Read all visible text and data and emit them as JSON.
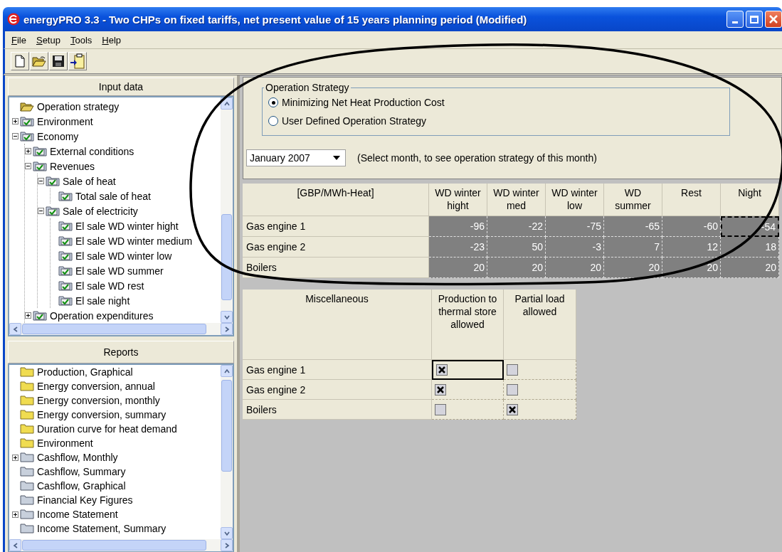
{
  "window": {
    "title": "energyPRO 3.3  -  Two CHPs on fixed tariffs, net present value of 15 years planning period (Modified)"
  },
  "menu": [
    {
      "label": "File"
    },
    {
      "label": "Setup"
    },
    {
      "label": "Tools"
    },
    {
      "label": "Help"
    }
  ],
  "toolbar": [
    {
      "kind": "new"
    },
    {
      "kind": "open"
    },
    {
      "kind": "save"
    },
    {
      "kind": "import"
    }
  ],
  "input_panel": {
    "title": "Input data",
    "tree": [
      {
        "label": "Operation strategy",
        "kind": "open-folder"
      },
      {
        "label": "Environment",
        "kind": "checked-folder",
        "expanded": false
      },
      {
        "label": "Economy",
        "kind": "checked-folder",
        "expanded": true,
        "children": [
          {
            "label": "External conditions",
            "kind": "checked-folder",
            "expanded": false
          },
          {
            "label": "Revenues",
            "kind": "checked-folder",
            "expanded": true,
            "children": [
              {
                "label": "Sale of heat",
                "kind": "checked-folder",
                "expanded": true,
                "children": [
                  {
                    "label": "Total sale of heat",
                    "kind": "checked-folder"
                  }
                ]
              },
              {
                "label": "Sale of electricity",
                "kind": "checked-folder",
                "expanded": true,
                "children": [
                  {
                    "label": "El sale WD winter hight",
                    "kind": "checked-folder"
                  },
                  {
                    "label": "El sale WD winter medium",
                    "kind": "checked-folder"
                  },
                  {
                    "label": "El sale WD winter low",
                    "kind": "checked-folder"
                  },
                  {
                    "label": "El sale WD summer",
                    "kind": "checked-folder"
                  },
                  {
                    "label": "El sale WD rest",
                    "kind": "checked-folder"
                  },
                  {
                    "label": "El sale night",
                    "kind": "checked-folder"
                  }
                ]
              }
            ]
          },
          {
            "label": "Operation expenditures",
            "kind": "checked-folder",
            "expanded": false
          }
        ]
      }
    ]
  },
  "reports_panel": {
    "title": "Reports",
    "tree": [
      {
        "label": "Production, Graphical",
        "kind": "yellow-folder"
      },
      {
        "label": "Energy conversion, annual",
        "kind": "yellow-folder"
      },
      {
        "label": "Energy conversion, monthly",
        "kind": "yellow-folder"
      },
      {
        "label": "Energy conversion, summary",
        "kind": "yellow-folder"
      },
      {
        "label": "Duration curve for heat demand",
        "kind": "yellow-folder"
      },
      {
        "label": "Environment",
        "kind": "yellow-folder"
      },
      {
        "label": "Cashflow, Monthly",
        "kind": "grey-folder",
        "expanded": false
      },
      {
        "label": "Cashflow, Summary",
        "kind": "grey-folder"
      },
      {
        "label": "Cashflow, Graphical",
        "kind": "grey-folder"
      },
      {
        "label": "Financial Key Figures",
        "kind": "grey-folder"
      },
      {
        "label": "Income Statement",
        "kind": "grey-folder",
        "expanded": false
      },
      {
        "label": "Income Statement, Summary",
        "kind": "grey-folder"
      }
    ]
  },
  "operation_strategy": {
    "title": "Operation Strategy",
    "options": [
      {
        "label": "Minimizing Net Heat Production Cost",
        "selected": true
      },
      {
        "label": "User Defined Operation Strategy",
        "selected": false
      }
    ]
  },
  "month": {
    "value": "January 2007",
    "hint": "(Select month, to see operation strategy of this month)"
  },
  "price_table": {
    "corner": "[GBP/MWh-Heat]",
    "columns": [
      "WD winter hight",
      "WD winter med",
      "WD winter low",
      "WD summer",
      "Rest",
      "Night"
    ],
    "rows": [
      {
        "label": "Gas engine 1",
        "cells": [
          {
            "value": "-96",
            "focused": false
          },
          {
            "value": "-22",
            "focused": false
          },
          {
            "value": "-75",
            "focused": false
          },
          {
            "value": "-65",
            "focused": false
          },
          {
            "value": "-60",
            "focused": false
          },
          {
            "value": "-54",
            "focused": true
          }
        ]
      },
      {
        "label": "Gas engine 2",
        "cells": [
          {
            "value": "-23",
            "focused": false
          },
          {
            "value": "50",
            "focused": false
          },
          {
            "value": "-3",
            "focused": false
          },
          {
            "value": "7",
            "focused": false
          },
          {
            "value": "12",
            "focused": false
          },
          {
            "value": "18",
            "focused": false
          }
        ]
      },
      {
        "label": "Boilers",
        "cells": [
          {
            "value": "20",
            "focused": false
          },
          {
            "value": "20",
            "focused": false
          },
          {
            "value": "20",
            "focused": false
          },
          {
            "value": "20",
            "focused": false
          },
          {
            "value": "20",
            "focused": false
          },
          {
            "value": "20",
            "focused": false
          }
        ]
      }
    ]
  },
  "misc_table": {
    "corner": "Miscellaneous",
    "columns": [
      "Production to thermal store allowed",
      "Partial load allowed"
    ],
    "rows": [
      {
        "label": "Gas engine 1",
        "cells": [
          {
            "checked": true,
            "focused": true
          },
          {
            "checked": false,
            "focused": false
          }
        ]
      },
      {
        "label": "Gas engine 2",
        "cells": [
          {
            "checked": true,
            "focused": false
          },
          {
            "checked": false,
            "focused": false
          }
        ]
      },
      {
        "label": "Boilers",
        "cells": [
          {
            "checked": false,
            "focused": false
          },
          {
            "checked": true,
            "focused": false
          }
        ]
      }
    ]
  }
}
